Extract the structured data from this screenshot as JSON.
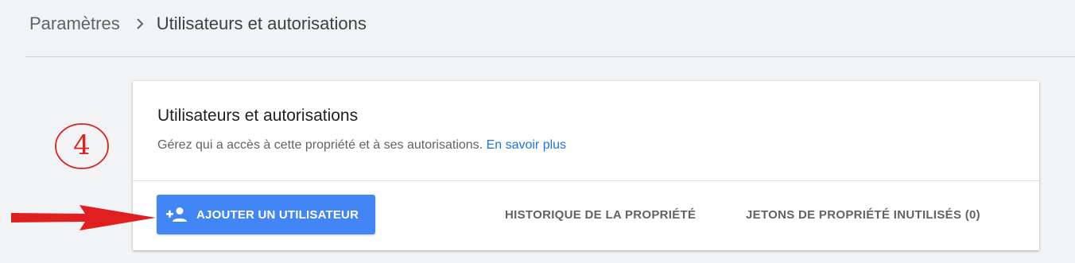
{
  "breadcrumb": {
    "parent": "Paramètres",
    "separator_icon": "chevron-right-icon",
    "current": "Utilisateurs et autorisations"
  },
  "card": {
    "title": "Utilisateurs et autorisations",
    "description": "Gérez qui a accès à cette propriété et à ses autorisations.",
    "learn_more": "En savoir plus"
  },
  "actions": {
    "add_user_label": "AJOUTER UN UTILISATEUR",
    "add_user_icon": "person-add-icon",
    "property_history_label": "HISTORIQUE DE LA PROPRIÉTÉ",
    "unused_tokens_label": "JETONS DE PROPRIÉTÉ INUTILISÉS (0)"
  },
  "annotation": {
    "step_number": "4",
    "color": "#e02020"
  },
  "colors": {
    "primary": "#4285f4",
    "link": "#1a73e8",
    "background": "#f1f3f4"
  }
}
